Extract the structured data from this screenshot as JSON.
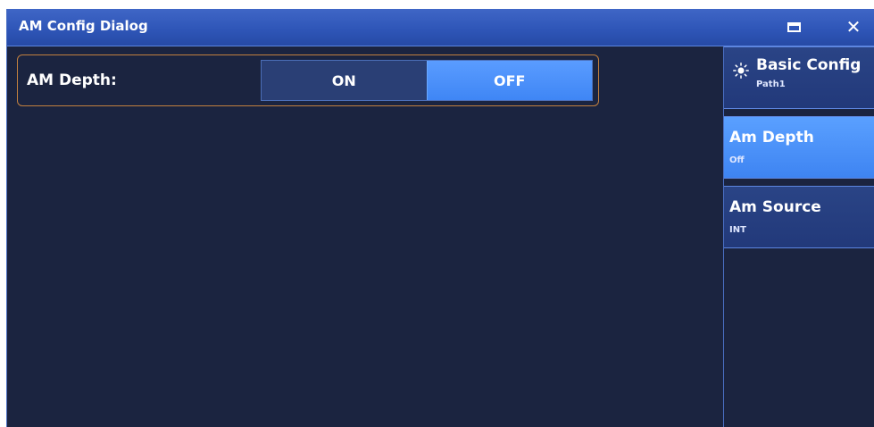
{
  "window": {
    "title": "AM Config Dialog",
    "maximize_icon": "maximize-icon",
    "close_icon": "close-icon",
    "close_glyph": "✕"
  },
  "form": {
    "am_depth": {
      "label": "AM Depth:",
      "options": [
        "ON",
        "OFF"
      ],
      "selected": "OFF"
    }
  },
  "sidebar": {
    "items": [
      {
        "label": "Basic Config",
        "sub": "Path1",
        "icon": "sun-icon",
        "active": false
      },
      {
        "label": "Am Depth",
        "sub": "Off",
        "active": true
      },
      {
        "label": "Am Source",
        "sub": "INT",
        "active": false
      }
    ]
  },
  "colors": {
    "background": "#1b2440",
    "titlebar": "#2f56b8",
    "accent": "#4a90ff",
    "border_highlight": "#c2803f"
  }
}
